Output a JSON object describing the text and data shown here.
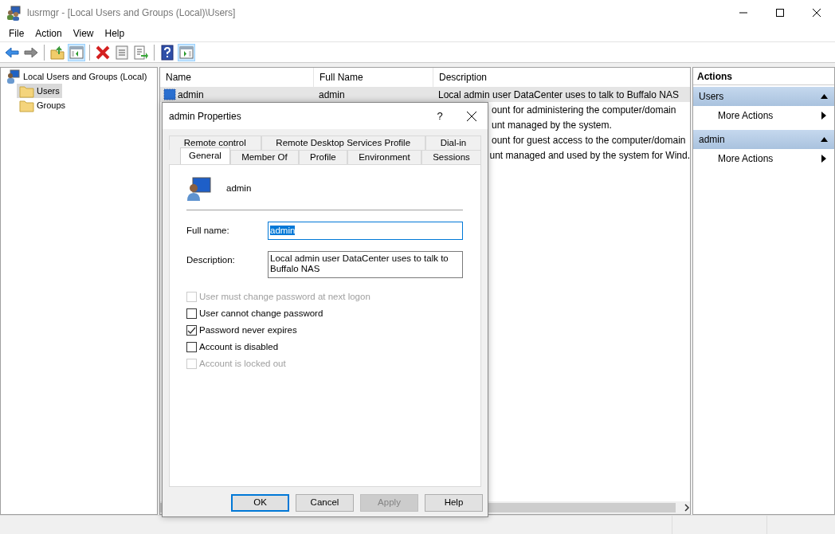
{
  "window": {
    "title": "lusrmgr - [Local Users and Groups (Local)\\Users]"
  },
  "menu": [
    "File",
    "Action",
    "View",
    "Help"
  ],
  "toolbar": [
    {
      "kind": "back",
      "pressed": false
    },
    {
      "kind": "forward",
      "pressed": false
    },
    {
      "kind": "separator"
    },
    {
      "kind": "up",
      "pressed": false
    },
    {
      "kind": "tree",
      "pressed": true
    },
    {
      "kind": "separator"
    },
    {
      "kind": "delete",
      "pressed": false
    },
    {
      "kind": "properties",
      "pressed": false
    },
    {
      "kind": "export",
      "pressed": false
    },
    {
      "kind": "separator"
    },
    {
      "kind": "help",
      "pressed": false
    },
    {
      "kind": "actionpane",
      "pressed": true
    }
  ],
  "tree": [
    {
      "label": "Local Users and Groups (Local)",
      "selected": false,
      "children": [
        {
          "label": "Users",
          "selected": true
        },
        {
          "label": "Groups",
          "selected": false
        }
      ]
    }
  ],
  "list": {
    "columns": [
      "Name",
      "Full Name",
      "Description"
    ],
    "rows": [
      {
        "name": "admin",
        "full_name": "admin",
        "description": "Local admin user DataCenter uses to talk to Buffalo NAS",
        "selected": true
      },
      {
        "description": "ount for administering the computer/domain",
        "selected": false
      },
      {
        "description": "unt managed by the system.",
        "selected": false
      },
      {
        "description": "ount for guest access to the computer/domain",
        "selected": false
      },
      {
        "description": "unt managed and used by the system for Wind.",
        "selected": false
      }
    ]
  },
  "actions": {
    "title": "Actions",
    "sections": [
      {
        "title": "Users",
        "items": [
          "More Actions"
        ]
      },
      {
        "title": "admin",
        "items": [
          "More Actions"
        ]
      }
    ]
  },
  "dialog": {
    "title": "admin Properties",
    "help": "?",
    "tab_rows": [
      [
        {
          "label": "Remote control",
          "selected": false
        },
        {
          "label": "Remote Desktop Services Profile",
          "selected": false
        },
        {
          "label": "Dial-in",
          "selected": false
        }
      ],
      [
        {
          "label": "General",
          "selected": true
        },
        {
          "label": "Member Of",
          "selected": false
        },
        {
          "label": "Profile",
          "selected": false
        },
        {
          "label": "Environment",
          "selected": false
        },
        {
          "label": "Sessions",
          "selected": false
        }
      ]
    ],
    "user_name": "admin",
    "fields": [
      {
        "label": "Full name:",
        "value": "admin",
        "focused": true
      },
      {
        "label": "Description:",
        "value": "Local admin user DataCenter uses to talk to Buffalo NAS",
        "focused": false
      }
    ],
    "checkboxes": [
      {
        "label": "User must change password at next logon",
        "checked": false,
        "disabled": true
      },
      {
        "label": "User cannot change password",
        "checked": false,
        "disabled": false
      },
      {
        "label": "Password never expires",
        "checked": true,
        "disabled": false
      },
      {
        "label": "Account is disabled",
        "checked": false,
        "disabled": false
      },
      {
        "label": "Account is locked out",
        "checked": false,
        "disabled": true
      }
    ],
    "buttons": [
      {
        "label": "OK",
        "default": true,
        "disabled": false
      },
      {
        "label": "Cancel",
        "default": false,
        "disabled": false
      },
      {
        "label": "Apply",
        "default": false,
        "disabled": true
      },
      {
        "label": "Help",
        "default": false,
        "disabled": false
      }
    ]
  }
}
